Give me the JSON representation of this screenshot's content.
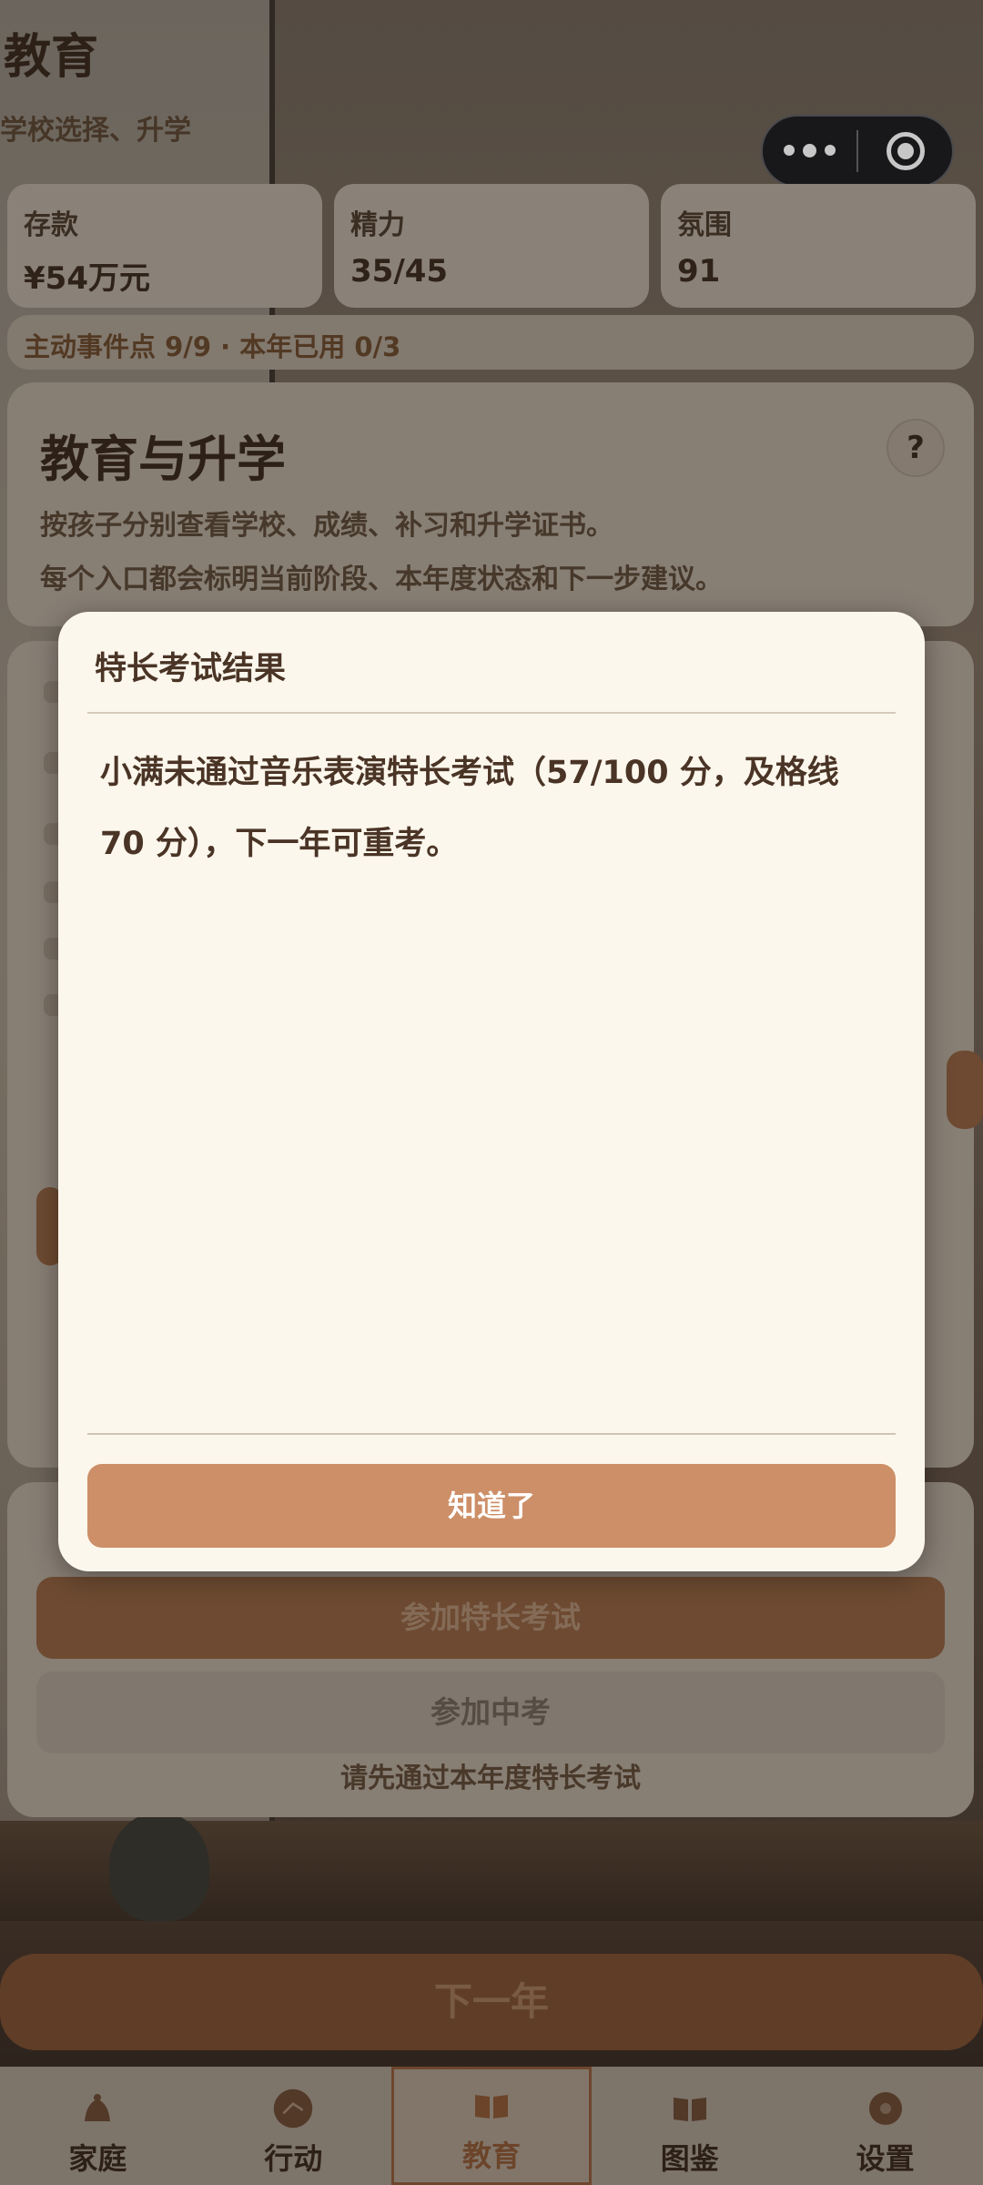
{
  "header": {
    "title": "教育",
    "subtitle": "学校选择、升学"
  },
  "stats": [
    {
      "label": "存款",
      "value": "¥54万元"
    },
    {
      "label": "精力",
      "value": "35/45"
    },
    {
      "label": "氛围",
      "value": "91"
    }
  ],
  "event_strip": "主动事件点 9/9 · 本年已用 0/3",
  "edu_card": {
    "title": "教育与升学",
    "help": "?",
    "desc1": "按孩子分别查看学校、成绩、补习和升学证书。",
    "desc2": "每个入口都会标明当前阶段、本年度状态和下一步建议。"
  },
  "stage_card": {
    "btn_talent": "参加特长考试",
    "btn_zhongkao": "参加中考",
    "hint": "请先通过本年度特长考试"
  },
  "next_year": "下一年",
  "tabs": [
    {
      "label": "家庭",
      "icon": "home-icon"
    },
    {
      "label": "行动",
      "icon": "action-icon"
    },
    {
      "label": "教育",
      "icon": "book-icon"
    },
    {
      "label": "图鉴",
      "icon": "album-icon"
    },
    {
      "label": "设置",
      "icon": "settings-icon"
    }
  ],
  "modal": {
    "title": "特长考试结果",
    "message": "小满未通过音乐表演特长考试（57/100 分，及格线 70 分），下一年可重考。",
    "ok": "知道了"
  },
  "colors": {
    "modal_bg": "#fcf7ec",
    "accent": "#cd8f68",
    "text": "#4a3426"
  }
}
